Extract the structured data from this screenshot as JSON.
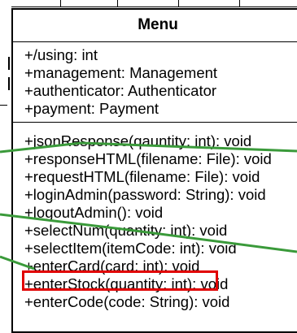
{
  "menu_class": {
    "title": "Menu",
    "attributes": [
      "+/using: int",
      "+management: Management",
      "+authenticator: Authenticator",
      "+payment: Payment"
    ],
    "operations": [
      "+jsonResponse(qauntity: int): void",
      "+responseHTML(filename: File): void",
      "+requestHTML(filename: File): void",
      "+loginAdmin(password: String): void",
      "+logoutAdmin(): void",
      "+selectNum(quantity: int): void",
      "+selectItem(itemCode: int): void",
      "+enterCard(card: int): void",
      "+enterStock(quantity: int): void",
      "+enterCode(code: String): void"
    ]
  },
  "colors": {
    "highlight": "#e10000",
    "connector": "#3a9a3a",
    "border": "#000000"
  }
}
